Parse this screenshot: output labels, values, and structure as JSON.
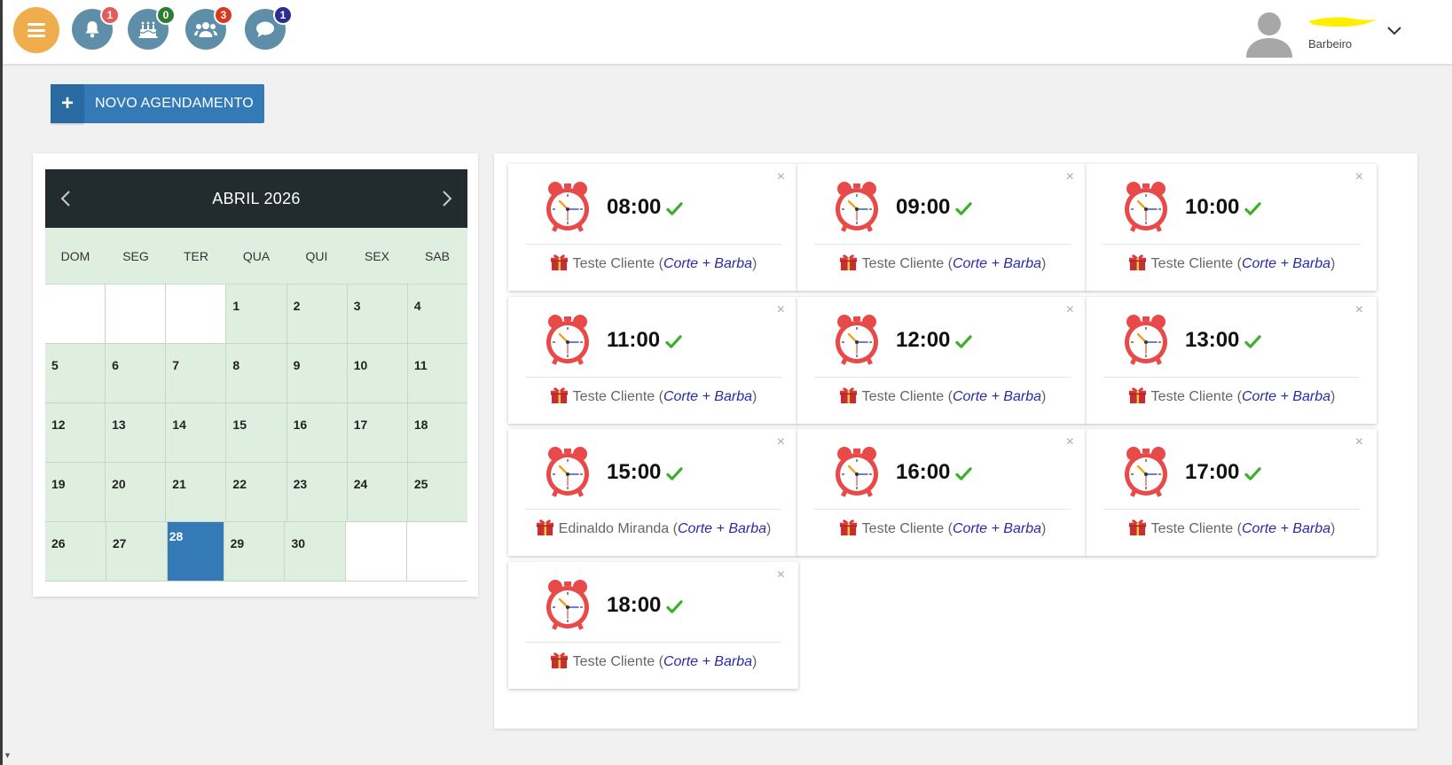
{
  "header": {
    "notifications": [
      {
        "name": "notifications",
        "icon": "bell-icon",
        "count": "1",
        "color": "#e45b5b"
      },
      {
        "name": "birthdays",
        "icon": "cake-icon",
        "count": "0",
        "color": "#2e7d32"
      },
      {
        "name": "clients",
        "icon": "users-icon",
        "count": "3",
        "color": "#d9391e"
      },
      {
        "name": "messages",
        "icon": "chat-icon",
        "count": "1",
        "color": "#2a2f8f"
      }
    ],
    "user_role": "Barbeiro"
  },
  "new_button": {
    "label": "NOVO AGENDAMENTO"
  },
  "calendar": {
    "month_label": "ABRIL 2026",
    "weekdays": [
      "DOM",
      "SEG",
      "TER",
      "QUA",
      "QUI",
      "SEX",
      "SAB"
    ],
    "weeks": [
      [
        "",
        "",
        "",
        "1",
        "2",
        "3",
        "4"
      ],
      [
        "5",
        "6",
        "7",
        "8",
        "9",
        "10",
        "11"
      ],
      [
        "12",
        "13",
        "14",
        "15",
        "16",
        "17",
        "18"
      ],
      [
        "19",
        "20",
        "21",
        "22",
        "23",
        "24",
        "25"
      ],
      [
        "26",
        "27",
        "28",
        "29",
        "30",
        "",
        ""
      ]
    ],
    "selected_day": "28"
  },
  "appointments": [
    {
      "time": "08:00",
      "client": "Teste Cliente",
      "service": "Corte + Barba"
    },
    {
      "time": "09:00",
      "client": "Teste Cliente",
      "service": "Corte + Barba"
    },
    {
      "time": "10:00",
      "client": "Teste Cliente",
      "service": "Corte + Barba"
    },
    {
      "time": "11:00",
      "client": "Teste Cliente",
      "service": "Corte + Barba"
    },
    {
      "time": "12:00",
      "client": "Teste Cliente",
      "service": "Corte + Barba"
    },
    {
      "time": "13:00",
      "client": "Teste Cliente",
      "service": "Corte + Barba"
    },
    {
      "time": "15:00",
      "client": "Edinaldo Miranda",
      "service": "Corte + Barba"
    },
    {
      "time": "16:00",
      "client": "Teste Cliente",
      "service": "Corte + Barba"
    },
    {
      "time": "17:00",
      "client": "Teste Cliente",
      "service": "Corte + Barba"
    },
    {
      "time": "18:00",
      "client": "Teste Cliente",
      "service": "Corte + Barba"
    }
  ],
  "colors": {
    "accent": "#337ab7",
    "menu": "#f0ad4e",
    "icon_bg": "#5f8fa8",
    "calendar_cell": "#dfefdf",
    "check": "#3cb02a"
  }
}
